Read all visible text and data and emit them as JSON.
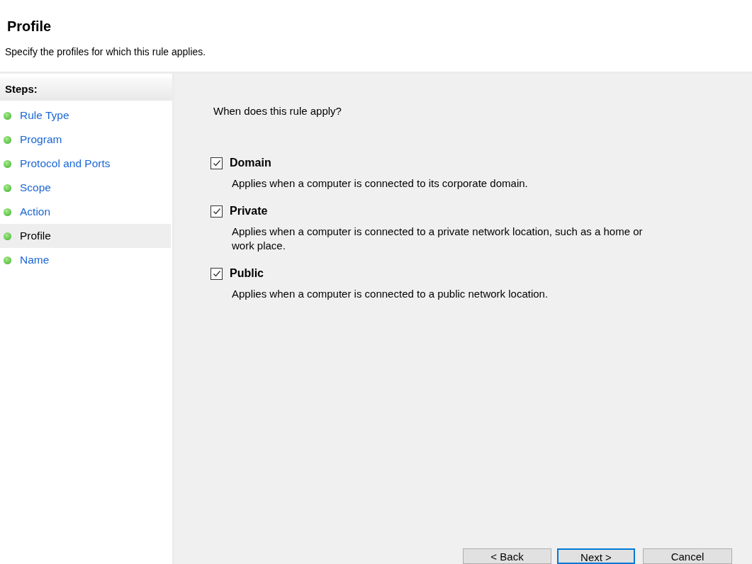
{
  "header": {
    "title": "Profile",
    "subtitle": "Specify the profiles for which this rule applies."
  },
  "steps": {
    "heading": "Steps:",
    "items": [
      {
        "label": "Rule Type",
        "selected": false
      },
      {
        "label": "Program",
        "selected": false
      },
      {
        "label": "Protocol and Ports",
        "selected": false
      },
      {
        "label": "Scope",
        "selected": false
      },
      {
        "label": "Action",
        "selected": false
      },
      {
        "label": "Profile",
        "selected": true
      },
      {
        "label": "Name",
        "selected": false
      }
    ]
  },
  "question": "When does this rule apply?",
  "profiles": [
    {
      "label": "Domain",
      "checked": true,
      "description": "Applies when a computer is connected to its corporate domain."
    },
    {
      "label": "Private",
      "checked": true,
      "description": "Applies when a computer is connected to a private network location, such as a home or work place."
    },
    {
      "label": "Public",
      "checked": true,
      "description": "Applies when a computer is connected to a public network location."
    }
  ],
  "buttons": [
    {
      "label": "< Back",
      "kind": "normal"
    },
    {
      "label": "Next >",
      "kind": "default"
    },
    {
      "label": "Cancel",
      "kind": "normal"
    }
  ]
}
